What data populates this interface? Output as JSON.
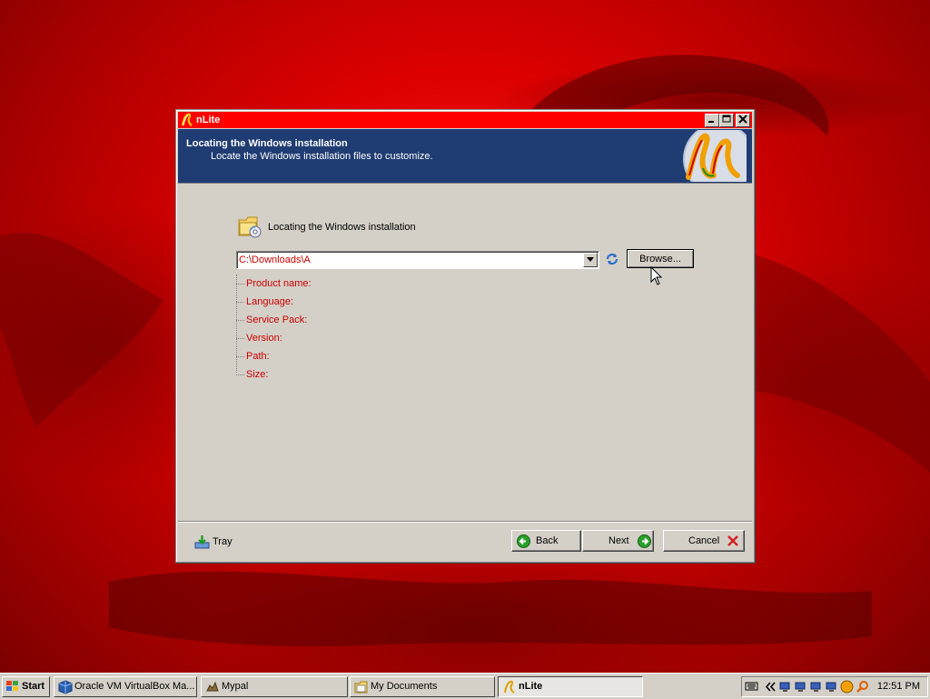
{
  "window": {
    "title": "nLite",
    "header_title": "Locating the Windows installation",
    "header_subtitle": "Locate the Windows installation files to customize.",
    "section_label": "Locating the Windows installation",
    "path_value": "C:\\Downloads\\A",
    "browse_label": "Browse...",
    "info_items": [
      {
        "label": "Product name:"
      },
      {
        "label": "Language:"
      },
      {
        "label": "Service Pack:"
      },
      {
        "label": "Version:"
      },
      {
        "label": "Path:"
      },
      {
        "label": "Size:"
      }
    ],
    "tray_label": "Tray",
    "back_label": "Back",
    "next_label": "Next",
    "cancel_label": "Cancel"
  },
  "taskbar": {
    "start_label": "Start",
    "tasks": [
      {
        "label": "Oracle VM VirtualBox Ma...",
        "icon": "virtualbox-icon"
      },
      {
        "label": "Mypal",
        "icon": "mypal-icon"
      },
      {
        "label": "My Documents",
        "icon": "folder-icon"
      },
      {
        "label": "nLite",
        "icon": "nlite-icon",
        "active": true
      }
    ],
    "clock": "12:51 PM"
  },
  "colors": {
    "titlebar": "#ff0000",
    "header_bg": "#1f3c73",
    "info_text": "#cc0000",
    "dialog_bg": "#d4d0c8"
  }
}
